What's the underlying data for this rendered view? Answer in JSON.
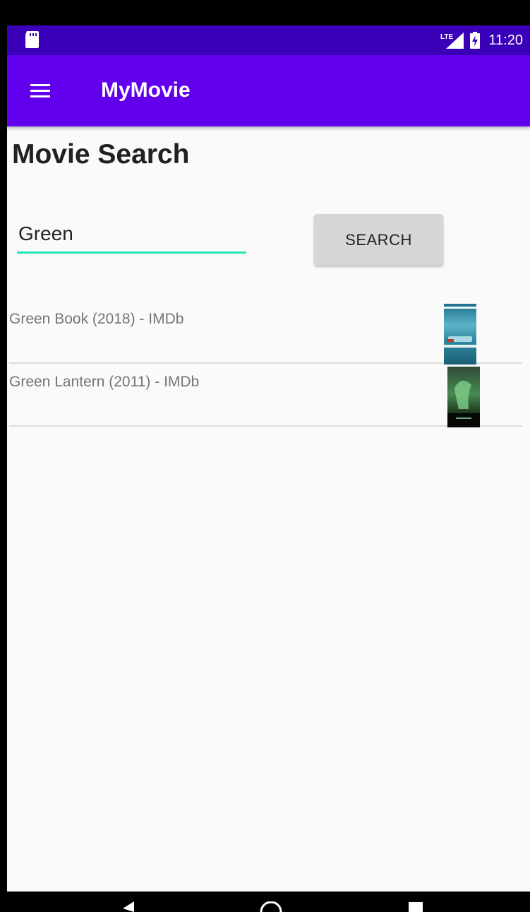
{
  "status_bar": {
    "time": "11:20",
    "network_icon": "lte-signal-icon",
    "battery_icon": "battery-charging-icon",
    "storage_icon": "sd-card-icon"
  },
  "app_bar": {
    "title": "MyMovie",
    "menu_icon": "menu-icon",
    "color": "#6200ee"
  },
  "page": {
    "title": "Movie Search"
  },
  "search": {
    "value": "Green",
    "placeholder": "",
    "button_label": "SEARCH",
    "accent_color": "#1de9b6"
  },
  "results": [
    {
      "title": "Green Book (2018) - IMDb",
      "poster": "green-book-poster"
    },
    {
      "title": "Green Lantern (2011) - IMDb",
      "poster": "green-lantern-poster"
    }
  ],
  "nav_bar": {
    "icons": [
      "back-icon",
      "home-icon",
      "recents-icon"
    ]
  }
}
